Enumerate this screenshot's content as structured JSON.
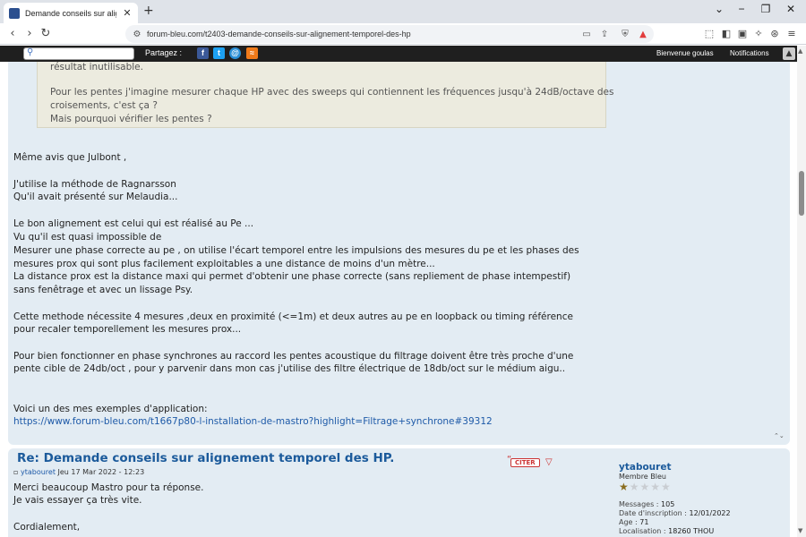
{
  "browser": {
    "tab_title": "Demande conseils sur alignement...",
    "new_tab": "+",
    "url": "forum-bleu.com/t2403-demande-conseils-sur-alignement-temporel-des-hp",
    "nav": {
      "back": "‹",
      "forward": "›",
      "reload": "↻"
    },
    "window": {
      "list": "⌄",
      "minimize": "−",
      "maximize": "❐",
      "close": "✕"
    }
  },
  "forumbar": {
    "share_label": "Partagez :",
    "welcome": "Bienvenue goulas",
    "notifications": "Notifications",
    "social": [
      "f",
      "t",
      "@",
      "≈"
    ]
  },
  "post1": {
    "quote_lines": [
      "résultat inutilisable.",
      "",
      "Pour les pentes j'imagine mesurer chaque HP avec des sweeps qui contiennent les fréquences jusqu'à 24dB/octave des",
      "croisements, c'est ça ?",
      "Mais pourquoi vérifier les pentes ?"
    ],
    "body_lines": [
      "Même avis que Julbont ,",
      "J'utilise la méthode de Ragnarsson",
      "Qu'il avait présenté sur Melaudia...",
      "Le bon alignement est celui qui est réalisé au Pe ...",
      "Vu qu'il est quasi impossible de",
      "Mesurer une phase correcte au pe , on utilise l'écart temporel entre les impulsions des mesures du pe et les phases des",
      "mesures prox qui sont plus facilement exploitables a une distance de moins d'un mètre...",
      "La distance prox est la distance maxi qui permet d'obtenir une phase correcte (sans repliement de phase intempestif)",
      "sans fenêtrage et avec un lissage Psy.",
      "Cette methode nécessite 4 mesures ,deux en proximité (<=1m) et deux autres au pe en loopback ou timing référence",
      "pour recaler temporellement les mesures prox...",
      "Pour bien fonctionner en phase synchrones au raccord  les pentes acoustique du filtrage doivent être très proche d'une",
      "pente cible de 24db/oct , pour y parvenir dans mon cas j'utilise des filtre électrique de 18db/oct sur le médium aigu..",
      "Voici un des mes exemples d'application:",
      "https://www.forum-bleu.com/t1667p80-l-installation-de-mastro?highlight=Filtrage+synchrone#39312"
    ]
  },
  "post2": {
    "title": "Re: Demande conseils sur alignement temporel des HP.",
    "author": "ytabouret",
    "date": "Jeu 17 Mar 2022 - 12:23",
    "citer_label": "CITER",
    "body_lines": [
      "Merci beaucoup Mastro pour ta réponse.",
      "Je vais essayer ça très vite.",
      "Cordialement,"
    ],
    "profile": {
      "name": "ytabouret",
      "rank": "Membre Bleu",
      "stars_filled": 1,
      "stars_total": 5,
      "stats": [
        {
          "label": "Messages : ",
          "value": "105"
        },
        {
          "label": "Date d'inscription : ",
          "value": "12/01/2022"
        },
        {
          "label": "Age : ",
          "value": "71"
        },
        {
          "label": "Localisation : ",
          "value": "18260 THOU"
        }
      ]
    }
  }
}
